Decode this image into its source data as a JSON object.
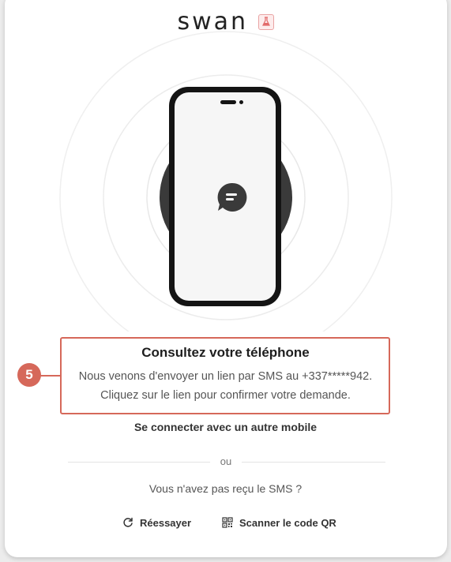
{
  "brand": {
    "name": "swan",
    "badge_icon": "flask-icon",
    "badge_color": "#e26a6a"
  },
  "illustration": {
    "chat_icon": "chat-bubble-icon",
    "accent": "#3a3a3a"
  },
  "callout": {
    "number": "5",
    "color": "#d6685a"
  },
  "content": {
    "title": "Consultez votre téléphone",
    "message_line1": "Nous venons d'envoyer un lien par SMS au +337*****942.",
    "message_line2": "Cliquez sur le lien pour confirmer votre demande."
  },
  "alt_mobile_link": "Se connecter avec un autre mobile",
  "divider_text": "ou",
  "sms_question": "Vous n'avez pas reçu le SMS ?",
  "actions": {
    "retry_label": "Réessayer",
    "retry_icon": "refresh-icon",
    "qr_label": "Scanner le code QR",
    "qr_icon": "qr-code-icon"
  }
}
